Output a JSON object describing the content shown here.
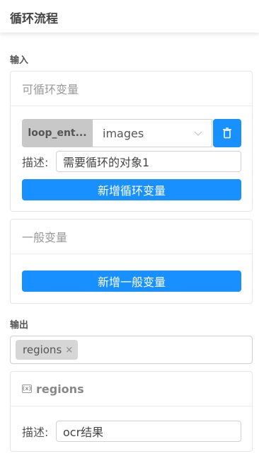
{
  "header": {
    "title": "循环流程"
  },
  "input_section": {
    "label": "输入",
    "loop_vars": {
      "title": "可循环变量",
      "item": {
        "tag": "loop_ent...",
        "select_value": "images",
        "desc_label": "描述:",
        "desc_value": "需要循环的对象1"
      },
      "add_button": "新增循环变量"
    },
    "general_vars": {
      "title": "一般变量",
      "add_button": "新增一般变量"
    }
  },
  "output_section": {
    "label": "输出",
    "chips": [
      {
        "label": "regions",
        "remove": "×"
      }
    ],
    "var_card": {
      "title": "regions",
      "desc_label": "描述:",
      "desc_value": "ocr结果"
    }
  },
  "colors": {
    "primary": "#1890ff",
    "tag_bg": "#c8c8c8"
  },
  "icons": {
    "select_arrow": "chevron-down-icon",
    "delete": "trash-icon",
    "variable": "variable-icon"
  }
}
